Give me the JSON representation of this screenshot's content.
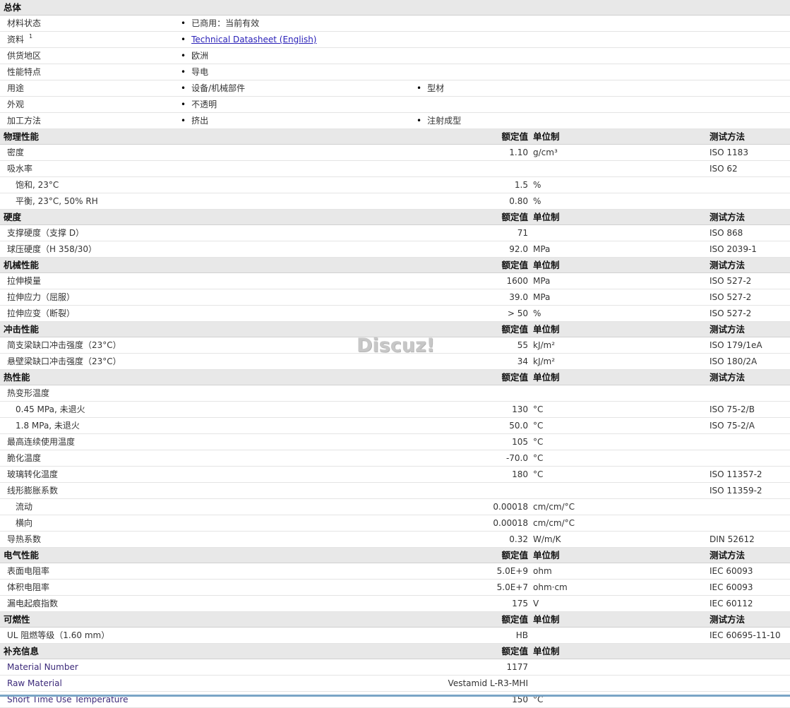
{
  "general": {
    "title": "总体",
    "rows": [
      {
        "label": "材料状态",
        "items": [
          "已商用：当前有效"
        ]
      },
      {
        "label": "资料",
        "sup": "1",
        "link": "Technical Datasheet (English)"
      },
      {
        "label": "供货地区",
        "items": [
          "欧洲"
        ]
      },
      {
        "label": "性能特点",
        "items": [
          "导电"
        ]
      },
      {
        "label": "用途",
        "items": [
          "设备/机械部件",
          "型材"
        ]
      },
      {
        "label": "外观",
        "items": [
          "不透明"
        ]
      },
      {
        "label": "加工方法",
        "items": [
          "挤出",
          "注射成型"
        ]
      }
    ]
  },
  "column_headers": {
    "value": "额定值",
    "unit": "单位制",
    "test": "测试方法"
  },
  "sections": [
    {
      "title": "物理性能",
      "has_test": true,
      "rows": [
        {
          "label": "密度",
          "value": "1.10",
          "unit": "g/cm³",
          "test": "ISO 1183"
        },
        {
          "label": "吸水率",
          "value": "",
          "unit": "",
          "test": "ISO 62"
        },
        {
          "label": "饱和, 23°C",
          "value": "1.5",
          "unit": "%",
          "test": "",
          "sub": true
        },
        {
          "label": "平衡, 23°C, 50% RH",
          "value": "0.80",
          "unit": "%",
          "test": "",
          "sub": true
        }
      ]
    },
    {
      "title": "硬度",
      "has_test": true,
      "rows": [
        {
          "label": "支撑硬度（支撑 D）",
          "value": "71",
          "unit": "",
          "test": "ISO 868"
        },
        {
          "label": "球压硬度（H 358/30）",
          "value": "92.0",
          "unit": "MPa",
          "test": "ISO 2039-1"
        }
      ]
    },
    {
      "title": "机械性能",
      "has_test": true,
      "rows": [
        {
          "label": "拉伸模量",
          "value": "1600",
          "unit": "MPa",
          "test": "ISO 527-2"
        },
        {
          "label": "拉伸应力（屈服）",
          "value": "39.0",
          "unit": "MPa",
          "test": "ISO 527-2"
        },
        {
          "label": "拉伸应变（断裂）",
          "value": "> 50",
          "unit": "%",
          "test": "ISO 527-2"
        }
      ]
    },
    {
      "title": "冲击性能",
      "has_test": true,
      "rows": [
        {
          "label": "简支梁缺口冲击强度（23°C）",
          "value": "55",
          "unit": "kJ/m²",
          "test": "ISO 179/1eA"
        },
        {
          "label": "悬壁梁缺口冲击强度（23°C）",
          "value": "34",
          "unit": "kJ/m²",
          "test": "ISO 180/2A"
        }
      ]
    },
    {
      "title": "热性能",
      "has_test": true,
      "rows": [
        {
          "label": "热变形温度",
          "value": "",
          "unit": "",
          "test": ""
        },
        {
          "label": "0.45 MPa, 未退火",
          "value": "130",
          "unit": "°C",
          "test": "ISO 75-2/B",
          "sub": true
        },
        {
          "label": "1.8 MPa, 未退火",
          "value": "50.0",
          "unit": "°C",
          "test": "ISO 75-2/A",
          "sub": true
        },
        {
          "label": "最高连续使用温度",
          "value": "105",
          "unit": "°C",
          "test": ""
        },
        {
          "label": "脆化温度",
          "value": "-70.0",
          "unit": "°C",
          "test": ""
        },
        {
          "label": "玻璃转化温度",
          "value": "180",
          "unit": "°C",
          "test": "ISO 11357-2"
        },
        {
          "label": "线形膨胀系数",
          "value": "",
          "unit": "",
          "test": "ISO 11359-2"
        },
        {
          "label": "流动",
          "value": "0.00018",
          "unit": "cm/cm/°C",
          "test": "",
          "sub": true
        },
        {
          "label": "横向",
          "value": "0.00018",
          "unit": "cm/cm/°C",
          "test": "",
          "sub": true
        },
        {
          "label": "导热系数",
          "value": "0.32",
          "unit": "W/m/K",
          "test": "DIN 52612"
        }
      ]
    },
    {
      "title": "电气性能",
      "has_test": true,
      "rows": [
        {
          "label": "表面电阻率",
          "value": "5.0E+9",
          "unit": "ohm",
          "test": "IEC 60093"
        },
        {
          "label": "体积电阻率",
          "value": "5.0E+7",
          "unit": "ohm·cm",
          "test": "IEC 60093"
        },
        {
          "label": "漏电起痕指数",
          "value": "175",
          "unit": "V",
          "test": "IEC 60112"
        }
      ]
    },
    {
      "title": "可燃性",
      "has_test": true,
      "rows": [
        {
          "label": "UL 阻燃等级（1.60 mm）",
          "value": "HB",
          "unit": "",
          "test": "IEC 60695-11-10"
        }
      ]
    },
    {
      "title": "补充信息",
      "has_test": false,
      "extra": true,
      "rows": [
        {
          "label": "Material Number",
          "value": "1177",
          "unit": "",
          "test": ""
        },
        {
          "label": "Raw Material",
          "value": "Vestamid L-R3-MHI",
          "unit": "",
          "test": ""
        },
        {
          "label": "Short Time Use Temperature",
          "value": "150",
          "unit": "°C",
          "test": ""
        }
      ]
    }
  ],
  "watermark": "Discuz!"
}
